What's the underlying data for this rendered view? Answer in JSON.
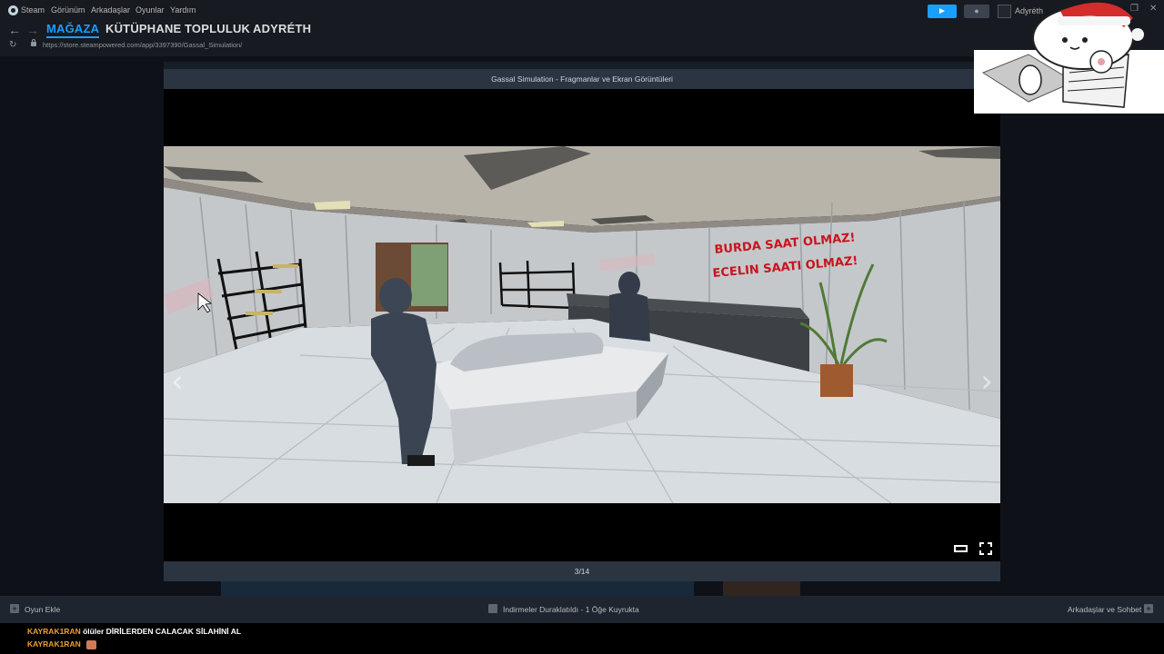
{
  "menu": {
    "items": [
      "Steam",
      "Görünüm",
      "Arkadaşlar",
      "Oyunlar",
      "Yardım"
    ],
    "username": "Adyréth"
  },
  "nav": {
    "tabs": [
      "MAĞAZA",
      "KÜTÜPHANE",
      "TOPLULUK",
      "ADYRÉTH"
    ],
    "url": "https://store.steampowered.com/app/3397390/Gassal_Simulation/"
  },
  "modal": {
    "title": "Gassal Simulation - Fragmanlar ve Ekran Görüntüleri",
    "counter": "3/14",
    "screenshot": {
      "sign_right_line1": "BURDA SAAT OLMAZ!",
      "sign_right_line2": "ECELIN SAATI OLMAZ!"
    }
  },
  "bottombar": {
    "add_game": "Oyun Ekle",
    "downloads": "İndirmeler Duraklatıldı - 1 Öğe Kuyrukta",
    "friends": "Arkadaşlar ve Sohbet"
  },
  "chat": [
    {
      "user": "KAYRAK1RAN",
      "message": "ölüler DİRİLERDEN CALACAK SİLAHİNİ AL"
    },
    {
      "user": "KAYRAK1RAN",
      "message": ""
    }
  ],
  "colors": {
    "accent": "#1a9fff",
    "chat_user": "#f0a030"
  }
}
